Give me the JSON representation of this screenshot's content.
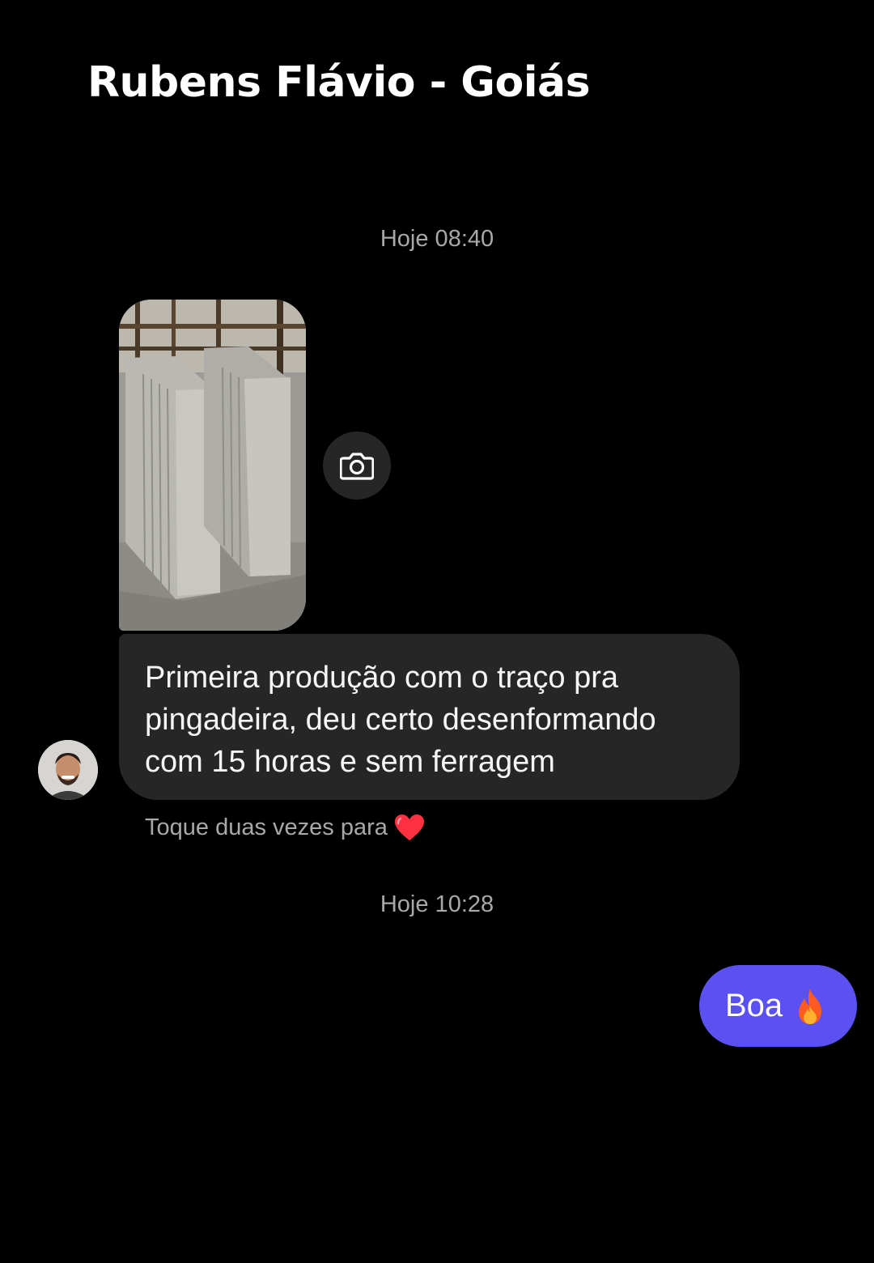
{
  "header": {
    "title": "Rubens Flávio - Goiás"
  },
  "conversation": {
    "timestamps": [
      "Hoje 08:40",
      "Hoje 10:28"
    ],
    "incoming": {
      "photo_icon": "photo-message",
      "camera_icon": "camera-icon",
      "text_lines": [
        "Primeira produção com o traço pra",
        "pingadeira, deu certo desenformando",
        "com 15 horas e sem ferragem"
      ],
      "like_hint": "Toque duas vezes para"
    },
    "outgoing": {
      "text": "Boa",
      "emoji_icon": "fire-icon"
    }
  },
  "colors": {
    "background": "#000000",
    "incoming_bubble": "#262626",
    "outgoing_bubble": "#5b51f0",
    "secondary_text": "#a8a8a8",
    "heart": "#ff3040"
  }
}
